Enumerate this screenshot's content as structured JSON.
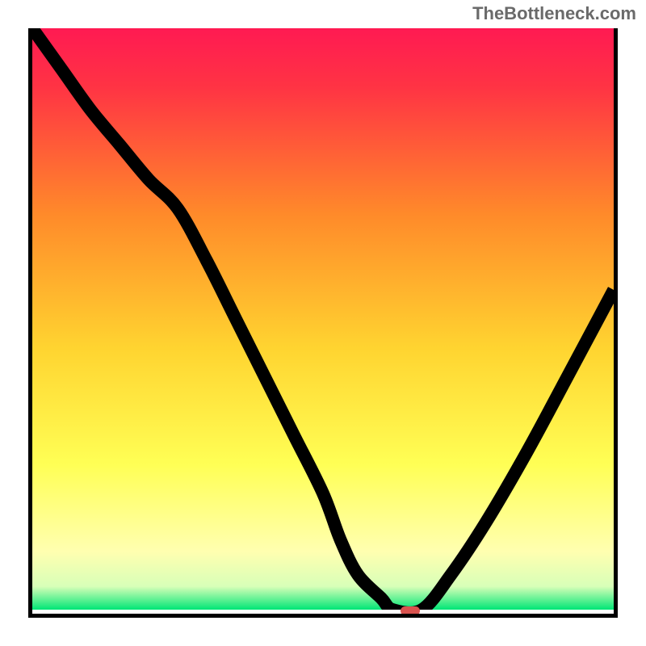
{
  "watermark": "TheBottleneck.com",
  "colors": {
    "top": "#ff1a52",
    "mid_red": "#ff3a3a",
    "orange": "#ff9a2a",
    "yellow": "#ffe030",
    "pale_yellow": "#ffff8a",
    "pale_green": "#e0ffb0",
    "green": "#00e676",
    "frame": "#000000",
    "curve": "#000000",
    "marker": "#d9534f"
  },
  "chart_data": {
    "type": "line",
    "title": "",
    "xlabel": "",
    "ylabel": "",
    "xlim": [
      0,
      100
    ],
    "ylim": [
      0,
      100
    ],
    "x": [
      0,
      5,
      10,
      15,
      20,
      25,
      30,
      35,
      40,
      45,
      50,
      53,
      56,
      60,
      62,
      67,
      72,
      78,
      85,
      92,
      100
    ],
    "values": [
      100,
      93,
      86,
      80,
      74,
      69,
      60,
      50,
      40,
      30,
      20,
      12,
      6,
      2,
      0,
      0,
      6,
      15,
      27,
      40,
      55
    ],
    "marker": {
      "x": 65,
      "y": 0,
      "width_pct": 3.2,
      "height_pct": 1.6
    },
    "gradient_stops": [
      {
        "pos": 0.0,
        "color": "#ff1a52"
      },
      {
        "pos": 0.1,
        "color": "#ff3344"
      },
      {
        "pos": 0.32,
        "color": "#ff8a2a"
      },
      {
        "pos": 0.55,
        "color": "#ffd430"
      },
      {
        "pos": 0.75,
        "color": "#ffff55"
      },
      {
        "pos": 0.9,
        "color": "#ffffb0"
      },
      {
        "pos": 0.96,
        "color": "#d8ffb8"
      },
      {
        "pos": 1.0,
        "color": "#00e676"
      }
    ]
  }
}
